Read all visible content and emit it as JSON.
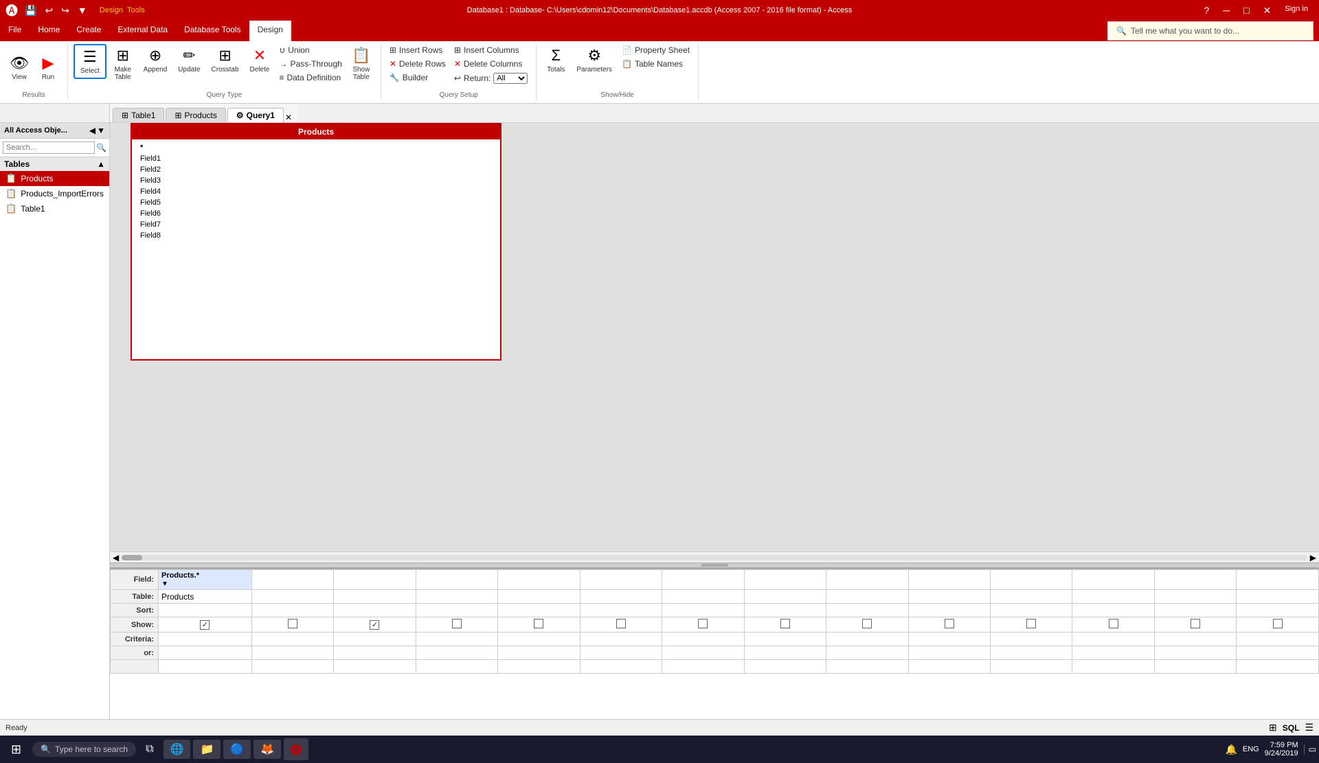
{
  "titleBar": {
    "title": "Database1 : Database- C:\\Users\\cdomin12\\Documents\\Database1.accdb (Access 2007 - 2016 file format) - Access",
    "quickAccess": [
      "💾",
      "↩",
      "↪",
      "▼"
    ],
    "controls": [
      "?",
      "─",
      "□",
      "✕"
    ],
    "signIn": "Sign in"
  },
  "ribbon": {
    "tabs": [
      "File",
      "Home",
      "Create",
      "External Data",
      "Database Tools",
      "Design"
    ],
    "activeTab": "Design",
    "searchPlaceholder": "Tell me what you want to do...",
    "groups": {
      "results": {
        "label": "Results",
        "buttons": [
          {
            "id": "view",
            "icon": "👁",
            "label": "View"
          },
          {
            "id": "run",
            "icon": "▶",
            "label": "Run"
          },
          {
            "id": "select",
            "icon": "☰",
            "label": "Select"
          },
          {
            "id": "makeTable",
            "icon": "⊞",
            "label": "Make\nTable"
          }
        ]
      },
      "queryType": {
        "label": "Query Type",
        "buttons": [
          {
            "id": "append",
            "icon": "⊕",
            "label": "Append"
          },
          {
            "id": "update",
            "icon": "✏",
            "label": "Update"
          },
          {
            "id": "crosstab",
            "icon": "⊞",
            "label": "Crosstab"
          },
          {
            "id": "delete",
            "icon": "✕",
            "label": "Delete"
          },
          {
            "id": "union",
            "icon": "∪",
            "label": "Union"
          },
          {
            "id": "passThrough",
            "icon": "→",
            "label": "Pass-Through"
          },
          {
            "id": "dataDefinition",
            "icon": "≡",
            "label": "Data Definition"
          },
          {
            "id": "showTable",
            "icon": "📋",
            "label": "Show\nTable"
          }
        ]
      },
      "querySetup": {
        "label": "Query Setup",
        "buttons": [
          {
            "id": "insertRows",
            "icon": "⊞",
            "label": "Insert Rows"
          },
          {
            "id": "deleteRows",
            "icon": "✕",
            "label": "Delete Rows"
          },
          {
            "id": "builder",
            "icon": "🔧",
            "label": "Builder"
          },
          {
            "id": "insertColumns",
            "icon": "⊞",
            "label": "Insert Columns"
          },
          {
            "id": "deleteColumns",
            "icon": "✕",
            "label": "Delete Columns"
          },
          {
            "id": "return",
            "icon": "↩",
            "label": "Return:",
            "value": "All"
          }
        ]
      },
      "showHide": {
        "label": "Show/Hide",
        "buttons": [
          {
            "id": "totals",
            "icon": "Σ",
            "label": "Totals"
          },
          {
            "id": "parameters",
            "icon": "⚙",
            "label": "Parameters"
          },
          {
            "id": "propertySheet",
            "icon": "📄",
            "label": "Property Sheet"
          },
          {
            "id": "tableNames",
            "icon": "📋",
            "label": "Table Names"
          }
        ]
      }
    }
  },
  "sidebar": {
    "title": "All Access Obje...",
    "searchPlaceholder": "Search...",
    "sections": [
      {
        "label": "Tables",
        "items": [
          {
            "name": "Products",
            "active": true
          },
          {
            "name": "Products_ImportErrors",
            "active": false
          },
          {
            "name": "Table1",
            "active": false
          }
        ]
      }
    ]
  },
  "docTabs": [
    {
      "label": "Table1",
      "active": false
    },
    {
      "label": "Products",
      "active": false
    },
    {
      "label": "Query1",
      "active": true
    }
  ],
  "tableCard": {
    "title": "Products",
    "fields": [
      "*",
      "Field1",
      "Field2",
      "Field3",
      "Field4",
      "Field5",
      "Field6",
      "Field7",
      "Field8"
    ]
  },
  "queryGrid": {
    "rows": [
      {
        "label": "Field:",
        "cells": [
          "Products.*",
          "",
          "",
          "",
          "",
          "",
          "",
          "",
          "",
          "",
          "",
          "",
          "",
          ""
        ]
      },
      {
        "label": "Table:",
        "cells": [
          "Products",
          "",
          "",
          "",
          "",
          "",
          "",
          "",
          "",
          "",
          "",
          "",
          "",
          ""
        ]
      },
      {
        "label": "Sort:",
        "cells": [
          "",
          "",
          "",
          "",
          "",
          "",
          "",
          "",
          "",
          "",
          "",
          "",
          "",
          ""
        ]
      },
      {
        "label": "Show:",
        "cells": [
          "checked",
          "",
          "checked",
          "",
          "",
          "",
          "",
          "",
          "",
          "",
          "",
          "",
          "",
          ""
        ],
        "type": "checkbox"
      },
      {
        "label": "Criteria:",
        "cells": [
          "",
          "",
          "",
          "",
          "",
          "",
          "",
          "",
          "",
          "",
          "",
          "",
          "",
          ""
        ]
      },
      {
        "label": "or:",
        "cells": [
          "",
          "",
          "",
          "",
          "",
          "",
          "",
          "",
          "",
          "",
          "",
          "",
          "",
          ""
        ]
      }
    ]
  },
  "statusBar": {
    "status": "Ready",
    "time": "7:59 PM",
    "date": "9/24/2019"
  },
  "taskbar": {
    "searchPlaceholder": "Type here to search",
    "apps": [
      "⊞",
      "🔍",
      "📂",
      "🌐",
      "🦊",
      "🅐"
    ],
    "time": "7:59 PM",
    "date": "9/24/2019"
  }
}
